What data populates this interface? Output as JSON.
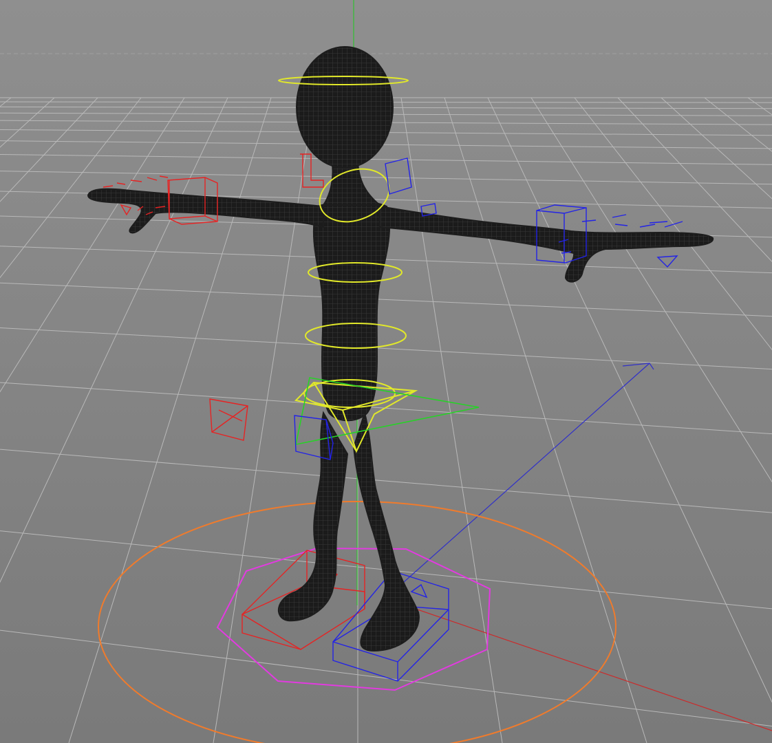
{
  "viewport": {
    "view": "perspective",
    "background_color": "#8a8a8a",
    "floor_grid": true,
    "grid_color": "#b9b9b9"
  },
  "colors": {
    "mesh": "#1d1d1d",
    "mesh_wire": "#3c3c3c",
    "axis_x": "#cc2a2a",
    "axis_y": "#2fbf2f",
    "axis_z": "#3030c8",
    "spine_controls": "#e1e82a",
    "left_controls": "#2323e6",
    "right_controls": "#e62323",
    "pelvis_control": "#27d227",
    "foot_pivot": "#e23be0",
    "root_control": "#f07b2c"
  },
  "rig": {
    "character": "t-pose-mannequin",
    "controls": [
      "head-ring-icon",
      "neck-ring-icon",
      "chest-ring-icon",
      "spine-ring-icon",
      "hips-ring-icon",
      "pelvis-cog-icon",
      "right-hand-ik-icon",
      "left-hand-ik-icon",
      "right-knee-pole-icon",
      "left-knee-pole-icon",
      "right-foot-ik-icon",
      "left-foot-ik-icon",
      "foot-pivot-octagon-icon",
      "root-circle-icon"
    ]
  }
}
